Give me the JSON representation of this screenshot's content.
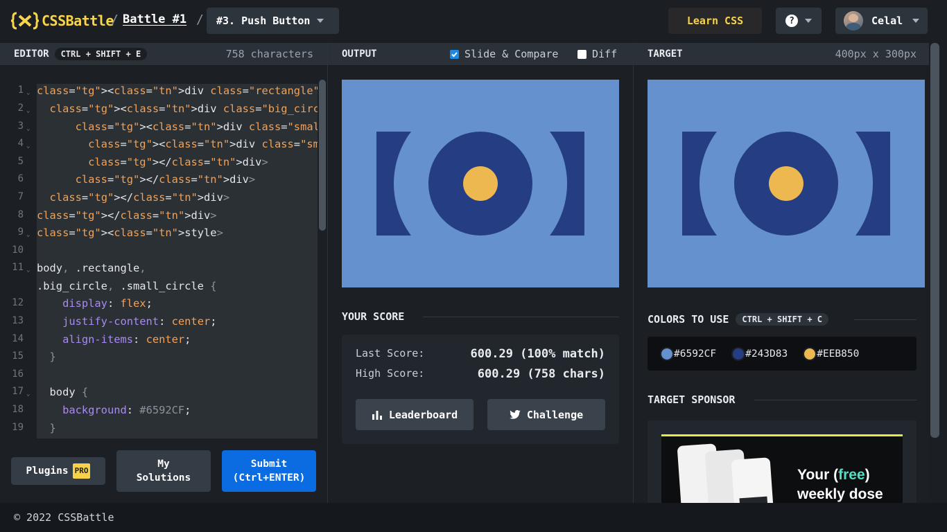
{
  "header": {
    "logo": "CSSBattle",
    "breadcrumb_sep": "/",
    "battle": "Battle #1",
    "target_select": "#3. Push Button",
    "learn": "Learn CSS",
    "help_symbol": "?",
    "user": "Celal"
  },
  "editor": {
    "title": "EDITOR",
    "shortcut": "CTRL + SHIFT + E",
    "char_count": "758 characters",
    "line_numbers": [
      "1",
      "2",
      "3",
      "4",
      "5",
      "6",
      "7",
      "8",
      "9",
      "10",
      "11",
      "12",
      "13",
      "14",
      "15",
      "16",
      "17",
      "18",
      "19"
    ],
    "lines": [
      "<div class=\"rectangle\">",
      "  <div class=\"big_circle\">",
      "      <div class=\"small_circle\">",
      "        <div class=\"smallest_circle\">",
      "        </div>",
      "      </div>",
      "  </div>",
      "</div>",
      "<style>",
      "",
      "body, .rectangle,",
      ".big_circle, .small_circle {",
      "    display: flex;",
      "    justify-content: center;",
      "    align-items: center;",
      "  }",
      "",
      "  body {",
      "    background: #6592CF;",
      "  }"
    ],
    "plugins": "Plugins",
    "pro_badge": "PRO",
    "my_solutions": "My Solutions",
    "submit": "Submit (Ctrl+ENTER)"
  },
  "output": {
    "title": "OUTPUT",
    "slide_compare": "Slide & Compare",
    "slide_compare_checked": true,
    "diff": "Diff",
    "diff_checked": false
  },
  "target": {
    "title": "TARGET",
    "size": "400px x 300px"
  },
  "score": {
    "title": "YOUR SCORE",
    "last_label": "Last Score:",
    "last_value": "600.29 (100% match)",
    "high_label": "High Score:",
    "high_value": "600.29 (758 chars)",
    "leaderboard": "Leaderboard",
    "challenge": "Challenge"
  },
  "colors": {
    "title": "COLORS TO USE",
    "shortcut": "CTRL + SHIFT + C",
    "swatches": [
      {
        "hex": "#6592CF",
        "color": "#6592cf"
      },
      {
        "hex": "#243D83",
        "color": "#243d83"
      },
      {
        "hex": "#EEB850",
        "color": "#eeb850"
      }
    ]
  },
  "sponsor": {
    "title": "TARGET SPONSOR",
    "text_line1_a": "Your (",
    "text_line1_b": "free",
    "text_line1_c": ")",
    "text_line2": "weekly dose"
  },
  "footer": {
    "copyright": "© 2022 CSSBattle"
  }
}
